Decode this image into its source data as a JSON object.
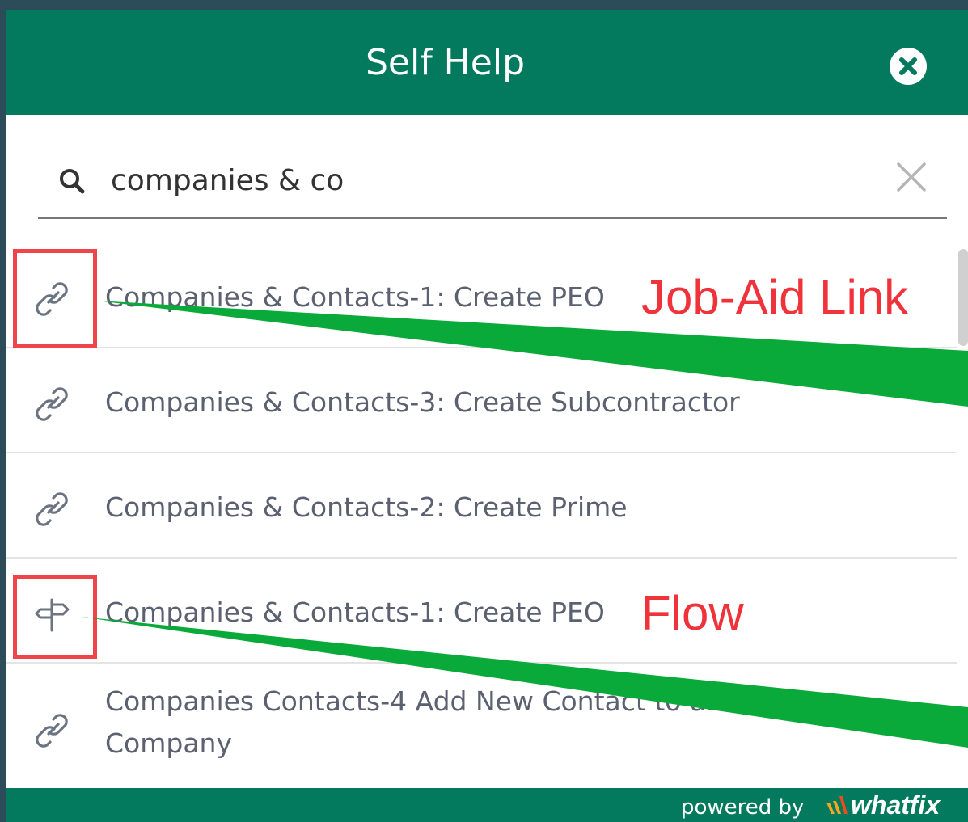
{
  "header": {
    "title": "Self Help"
  },
  "search": {
    "value": "companies & co",
    "placeholder": ""
  },
  "items": [
    {
      "label": "Companies & Contacts-1: Create PEO",
      "icon": "link-icon"
    },
    {
      "label": "Companies & Contacts-3: Create Subcontractor",
      "icon": "link-icon"
    },
    {
      "label": "Companies & Contacts-2: Create Prime",
      "icon": "link-icon"
    },
    {
      "label": "Companies & Contacts-1: Create PEO",
      "icon": "signpost-icon"
    },
    {
      "label": "Companies Contacts-4 Add New Contact to an Existing Company",
      "icon": "link-icon"
    }
  ],
  "annotations": {
    "job_aid_label": "Job-Aid Link",
    "flow_label": "Flow",
    "box_color": "#f0444b",
    "arrow_color": "#0aaa3a"
  },
  "footer": {
    "powered_by": "powered by",
    "brand": "whatfix"
  },
  "colors": {
    "primary": "#03795e",
    "text": "#5b6170"
  }
}
